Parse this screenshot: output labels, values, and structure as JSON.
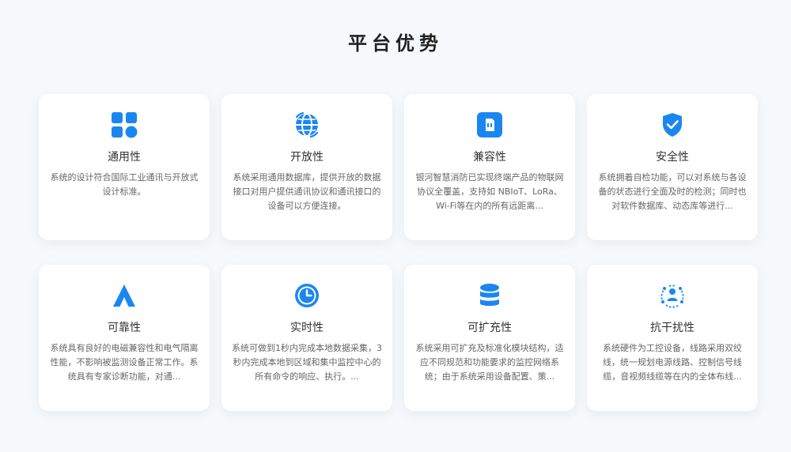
{
  "page": {
    "title": "平台优势"
  },
  "colors": {
    "accent": "#1a87f0",
    "background": "#f6f9fb",
    "card": "#ffffff"
  },
  "cards": [
    {
      "icon": "grid-apps-icon",
      "title": "通用性",
      "desc": "系统的设计符合国际工业通讯与开放式设计标准。"
    },
    {
      "icon": "globe-icon",
      "title": "开放性",
      "desc": "系统采用通用数据库，提供开放的数据接口对用户提供通讯协议和通讯接口的设备可以方便连接。"
    },
    {
      "icon": "sim-card-icon",
      "title": "兼容性",
      "desc": "银河智慧消防已实现终端产品的物联网协议全覆盖，支持如 NBIoT、LoRa、Wi-Fi等在内的所有远距离..."
    },
    {
      "icon": "shield-check-icon",
      "title": "安全性",
      "desc": "系统拥着自检功能，可以对系统与各设备的状态进行全面及时的检测；同时也对软件数据库、动态库等进行..."
    },
    {
      "icon": "triangle-icon",
      "title": "可靠性",
      "desc": "系统具有良好的电磁兼容性和电气隔离性能，不影响被监测设备正常工作。系统具有专家诊断功能，对通..."
    },
    {
      "icon": "clock-icon",
      "title": "实时性",
      "desc": "系统可做到1秒内完成本地数据采集，3秒内完成本地到区域和集中监控中心的所有命令的响应、执行。..."
    },
    {
      "icon": "database-icon",
      "title": "可扩充性",
      "desc": "系统采用可扩充及标准化模块结构，适应不同规范和功能要求的监控网络系统；由于系统采用设备配置、策..."
    },
    {
      "icon": "user-network-icon",
      "title": "抗干扰性",
      "desc": "系统硬件为工控设备，线路采用双绞线，统一规划电源线路、控制信号线缆，音视频线缆等在内的全体布线..."
    }
  ]
}
